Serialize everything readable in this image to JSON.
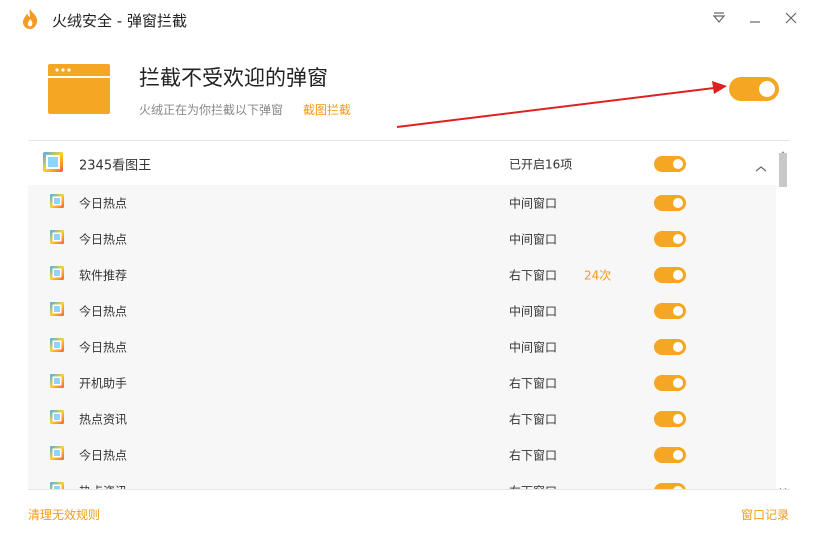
{
  "window": {
    "title": "火绒安全 - 弹窗拦截"
  },
  "header": {
    "title": "拦截不受欢迎的弹窗",
    "subtitle": "火绒正在为你拦截以下弹窗",
    "link": "截图拦截",
    "toggle_on": true
  },
  "group": {
    "name": "2345看图王",
    "status": "已开启16项",
    "toggle_on": true
  },
  "rows": [
    {
      "name": "今日热点",
      "position": "中间窗口",
      "count": "",
      "toggle_on": true
    },
    {
      "name": "今日热点",
      "position": "中间窗口",
      "count": "",
      "toggle_on": true
    },
    {
      "name": "软件推荐",
      "position": "右下窗口",
      "count": "24次",
      "toggle_on": true
    },
    {
      "name": "今日热点",
      "position": "中间窗口",
      "count": "",
      "toggle_on": true
    },
    {
      "name": "今日热点",
      "position": "中间窗口",
      "count": "",
      "toggle_on": true
    },
    {
      "name": "开机助手",
      "position": "右下窗口",
      "count": "",
      "toggle_on": true
    },
    {
      "name": "热点资讯",
      "position": "右下窗口",
      "count": "",
      "toggle_on": true
    },
    {
      "name": "今日热点",
      "position": "右下窗口",
      "count": "",
      "toggle_on": true
    },
    {
      "name": "热点资讯",
      "position": "右下窗口",
      "count": "",
      "toggle_on": true
    }
  ],
  "footer": {
    "left_link": "清理无效规则",
    "right_link": "窗口记录"
  },
  "colors": {
    "accent": "#f5a623",
    "link": "#f29b1e",
    "arrow": "#e02020"
  }
}
